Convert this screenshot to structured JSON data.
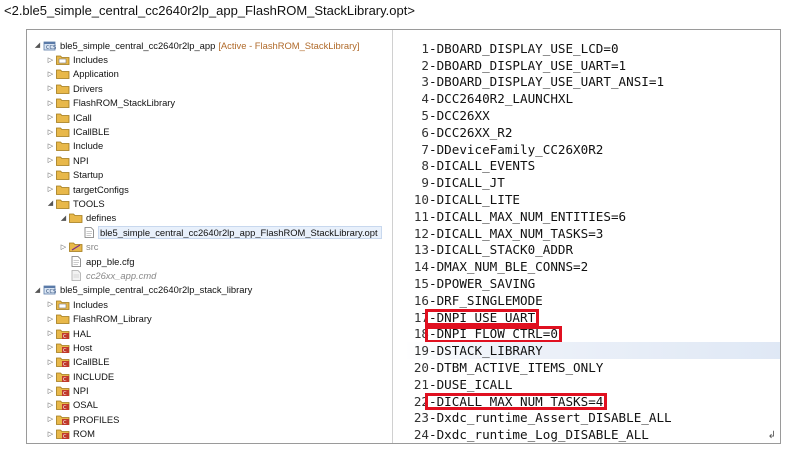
{
  "caption": "<2.ble5_simple_central_cc2640r2lp_app_FlashROM_StackLibrary.opt>",
  "tree": [
    {
      "indent": 0,
      "toggle": "open",
      "icon": "project",
      "label": "ble5_simple_central_cc2640r2lp_app",
      "tag": "[Active - FlashROM_StackLibrary]"
    },
    {
      "indent": 1,
      "toggle": "closed",
      "icon": "includes",
      "label": "Includes"
    },
    {
      "indent": 1,
      "toggle": "closed",
      "icon": "folder",
      "label": "Application"
    },
    {
      "indent": 1,
      "toggle": "closed",
      "icon": "folder",
      "label": "Drivers"
    },
    {
      "indent": 1,
      "toggle": "closed",
      "icon": "folder",
      "label": "FlashROM_StackLibrary"
    },
    {
      "indent": 1,
      "toggle": "closed",
      "icon": "folder",
      "label": "ICall"
    },
    {
      "indent": 1,
      "toggle": "closed",
      "icon": "folder",
      "label": "ICallBLE"
    },
    {
      "indent": 1,
      "toggle": "closed",
      "icon": "folder",
      "label": "Include"
    },
    {
      "indent": 1,
      "toggle": "closed",
      "icon": "folder",
      "label": "NPI"
    },
    {
      "indent": 1,
      "toggle": "closed",
      "icon": "folder",
      "label": "Startup"
    },
    {
      "indent": 1,
      "toggle": "closed",
      "icon": "folder",
      "label": "targetConfigs"
    },
    {
      "indent": 1,
      "toggle": "open",
      "icon": "folder",
      "label": "TOOLS"
    },
    {
      "indent": 2,
      "toggle": "open",
      "icon": "folder",
      "label": "defines"
    },
    {
      "indent": 3,
      "toggle": "none",
      "icon": "file",
      "label": "ble5_simple_central_cc2640r2lp_app_FlashROM_StackLibrary.opt",
      "selected": true
    },
    {
      "indent": 2,
      "toggle": "closed",
      "icon": "src-folder",
      "label": "src",
      "muted": true
    },
    {
      "indent": 2,
      "toggle": "none",
      "icon": "file",
      "label": "app_ble.cfg"
    },
    {
      "indent": 2,
      "toggle": "none",
      "icon": "file-gray",
      "label": "cc26xx_app.cmd",
      "muted": true,
      "italic": true
    },
    {
      "indent": 0,
      "toggle": "open",
      "icon": "project",
      "label": "ble5_simple_central_cc2640r2lp_stack_library"
    },
    {
      "indent": 1,
      "toggle": "closed",
      "icon": "includes",
      "label": "Includes"
    },
    {
      "indent": 1,
      "toggle": "closed",
      "icon": "folder",
      "label": "FlashROM_Library"
    },
    {
      "indent": 1,
      "toggle": "closed",
      "icon": "linked-folder",
      "label": "HAL"
    },
    {
      "indent": 1,
      "toggle": "closed",
      "icon": "linked-folder",
      "label": "Host"
    },
    {
      "indent": 1,
      "toggle": "closed",
      "icon": "linked-folder",
      "label": "ICallBLE"
    },
    {
      "indent": 1,
      "toggle": "closed",
      "icon": "linked-folder",
      "label": "INCLUDE"
    },
    {
      "indent": 1,
      "toggle": "closed",
      "icon": "linked-folder",
      "label": "NPI"
    },
    {
      "indent": 1,
      "toggle": "closed",
      "icon": "linked-folder",
      "label": "OSAL"
    },
    {
      "indent": 1,
      "toggle": "closed",
      "icon": "linked-folder",
      "label": "PROFILES"
    },
    {
      "indent": 1,
      "toggle": "closed",
      "icon": "linked-folder",
      "label": "ROM"
    }
  ],
  "code_lines": [
    {
      "n": "1",
      "text": "-DBOARD_DISPLAY_USE_LCD=0"
    },
    {
      "n": "2",
      "text": "-DBOARD_DISPLAY_USE_UART=1"
    },
    {
      "n": "3",
      "text": "-DBOARD_DISPLAY_USE_UART_ANSI=1"
    },
    {
      "n": "4",
      "text": "-DCC2640R2_LAUNCHXL"
    },
    {
      "n": "5",
      "text": "-DCC26XX"
    },
    {
      "n": "6",
      "text": "-DCC26XX_R2"
    },
    {
      "n": "7",
      "text": "-DDeviceFamily_CC26X0R2"
    },
    {
      "n": "8",
      "text": "-DICALL_EVENTS"
    },
    {
      "n": "9",
      "text": "-DICALL_JT"
    },
    {
      "n": "10",
      "text": "-DICALL_LITE"
    },
    {
      "n": "11",
      "text": "-DICALL_MAX_NUM_ENTITIES=6"
    },
    {
      "n": "12",
      "text": "-DICALL_MAX_NUM_TASKS=3"
    },
    {
      "n": "13",
      "text": "-DICALL_STACK0_ADDR"
    },
    {
      "n": "14",
      "text": "-DMAX_NUM_BLE_CONNS=2"
    },
    {
      "n": "15",
      "text": "-DPOWER_SAVING"
    },
    {
      "n": "16",
      "text": "-DRF_SINGLEMODE"
    },
    {
      "n": "17",
      "text": "-DNPI_USE_UART",
      "boxed": true
    },
    {
      "n": "18",
      "text": "-DNPI_FLOW_CTRL=0",
      "boxed": true
    },
    {
      "n": "19",
      "text": "-DSTACK_LIBRARY",
      "highlight": true
    },
    {
      "n": "20",
      "text": "-DTBM_ACTIVE_ITEMS_ONLY"
    },
    {
      "n": "21",
      "text": "-DUSE_ICALL"
    },
    {
      "n": "22",
      "text": "-DICALL_MAX_NUM_TASKS=4",
      "boxed": true
    },
    {
      "n": "23",
      "text": "-Dxdc_runtime_Assert_DISABLE_ALL"
    },
    {
      "n": "24",
      "text": "-Dxdc_runtime_Log_DISABLE_ALL"
    }
  ],
  "colors": {
    "annotation_box": "#e01020",
    "folder": "#e8b84a",
    "linked_folder_badge": "#c0392b",
    "active_tag": "#b06a2a"
  }
}
